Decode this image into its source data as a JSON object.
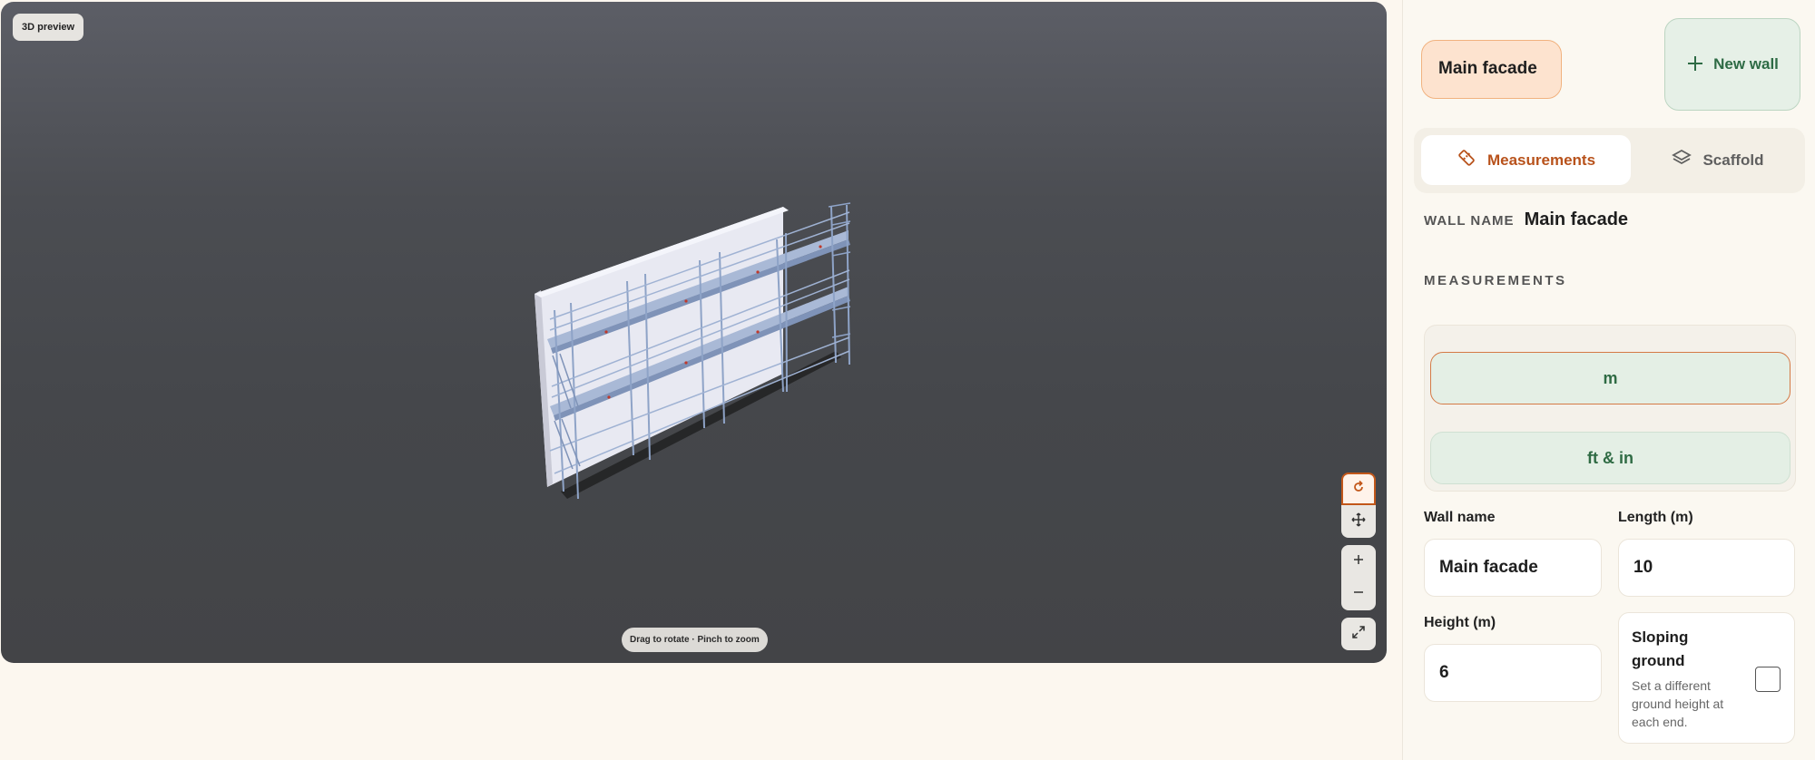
{
  "viewport": {
    "badge": "3D preview",
    "hint": "Drag to rotate · Pinch to zoom",
    "controls": [
      {
        "name": "rotate-mode-button",
        "icon": "rotate-icon",
        "glyph": "⟲",
        "active": true
      },
      {
        "name": "pan-mode-button",
        "icon": "move-icon",
        "glyph": "✥"
      },
      {
        "name": "zoom-in-button",
        "icon": "plus-icon",
        "glyph": "+"
      },
      {
        "name": "zoom-out-button",
        "icon": "minus-icon",
        "glyph": "−"
      },
      {
        "name": "fullscreen-button",
        "icon": "expand-icon",
        "glyph": "⤢"
      }
    ]
  },
  "panel": {
    "wall_chip": "Main facade",
    "new_wall_label": "New wall",
    "tabs": [
      {
        "label": "Measurements",
        "icon": "ruler-icon",
        "active": true
      },
      {
        "label": "Scaffold",
        "icon": "layers-icon",
        "active": false
      }
    ],
    "wall_name_key": "WALL NAME",
    "wall_name_value": "Main facade",
    "section_title": "MEASUREMENTS",
    "units": [
      {
        "label": "m",
        "selected": true
      },
      {
        "label": "ft & in",
        "selected": false
      }
    ],
    "fields": {
      "wall_name": {
        "label": "Wall name",
        "value": "Main facade"
      },
      "length": {
        "label": "Length (m)",
        "value": "10"
      },
      "height": {
        "label": "Height (m)",
        "value": "6"
      }
    },
    "sloping": {
      "title": "Sloping ground",
      "description": "Set a different ground height at each end.",
      "checked": false
    }
  },
  "colors": {
    "accent": "#c2571a",
    "green": "#2e6b45",
    "panel_bg": "#fbf8f1",
    "viewport_bg": "#4b4d52"
  }
}
